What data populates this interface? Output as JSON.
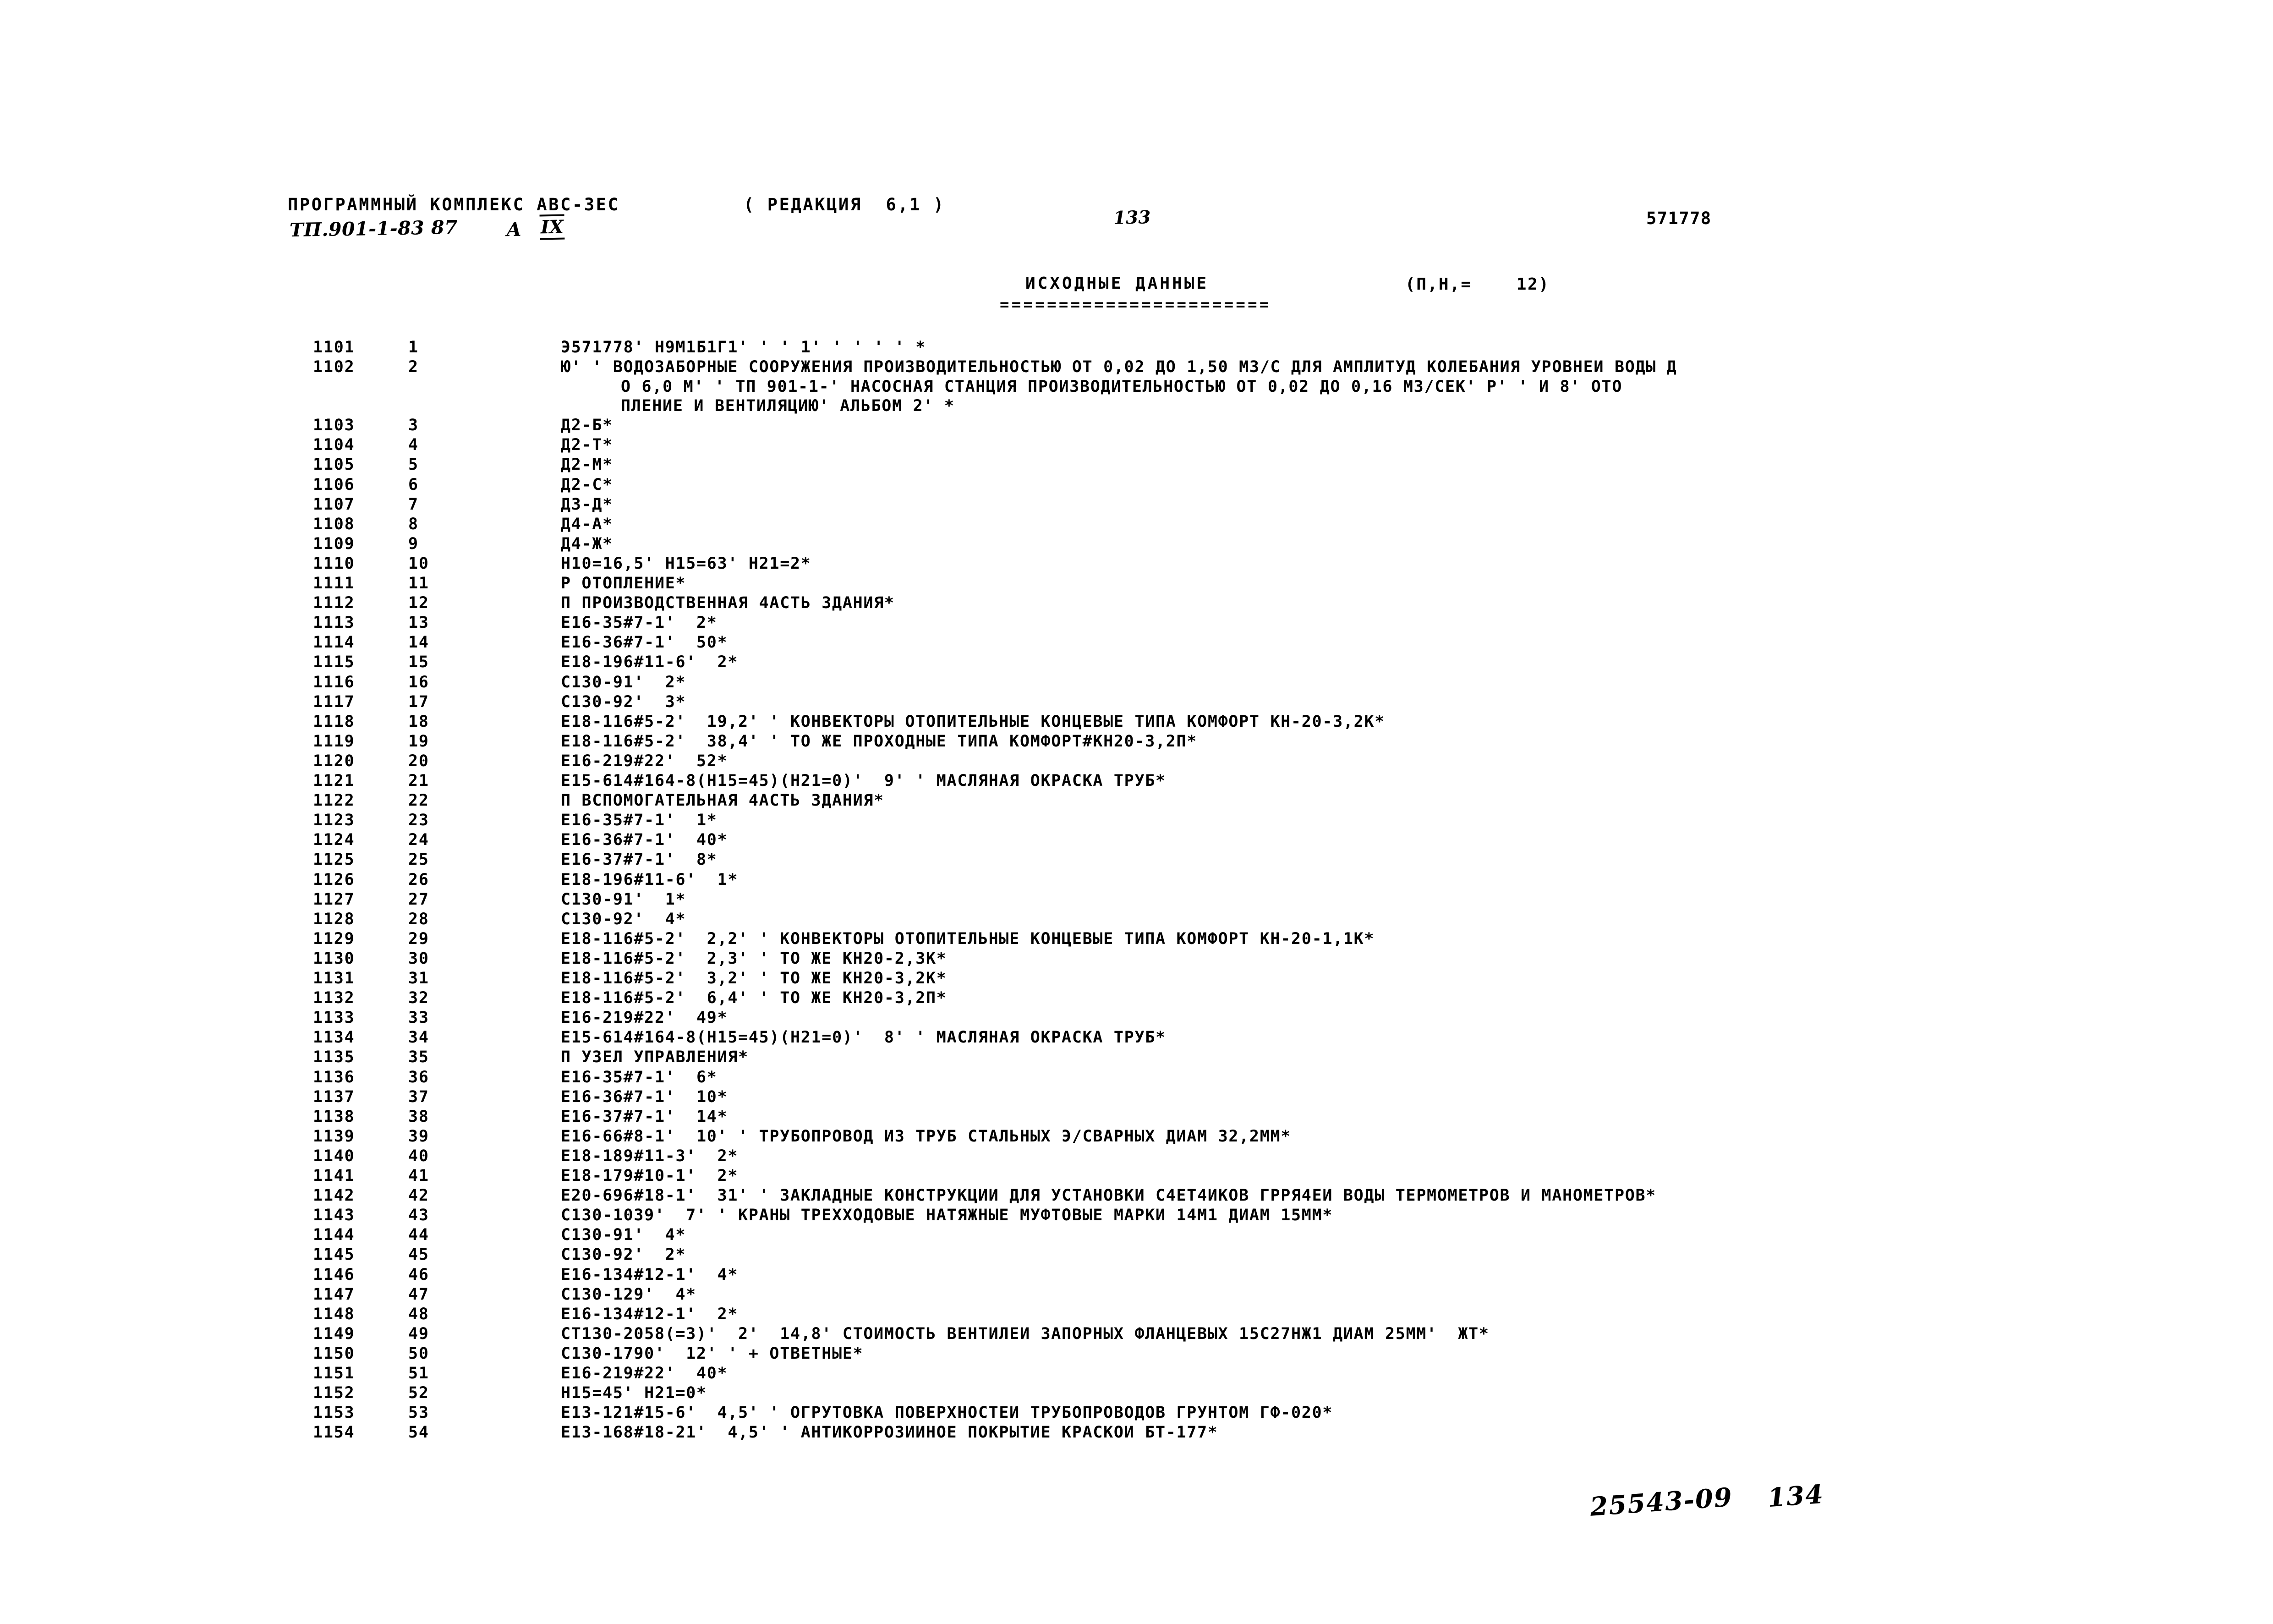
{
  "header": {
    "program_complex": "ПРОГРАММНЫЙ КОМПЛЕКС АВС-3ЕС",
    "revision": "( РЕДАКЦИЯ  6,1 )",
    "page_number": "133",
    "doc_code": "571778",
    "tp_label": "ТП.901-1-83 87",
    "album_letter": "А",
    "album_roman": "IX"
  },
  "section": {
    "title": "ИСХОДНЫЕ ДАННЫЕ",
    "rule": "=======================",
    "params": "(П,Н,=    12)"
  },
  "table": {
    "rows": [
      {
        "seq": "1101",
        "num": "1",
        "text": "Э571778' Н9М1Б1Г1' ' ' 1' ' ' ' ' *"
      },
      {
        "seq": "1102",
        "num": "2",
        "text": "Ю' ' ВОДОЗАБОРНЫЕ СООРУЖЕНИЯ ПРОИЗВОДИТЕЛЬНОСТЬЮ ОТ 0,02 ДО 1,50 М3/С ДЛЯ АМПЛИТУД КОЛЕБАНИЯ УРОВНЕИ ВОДЫ Д",
        "cont": [
          "О 6,0 М' ' ТП 901-1-' НАСОСНАЯ СТАНЦИЯ ПРОИЗВОДИТЕЛЬНОСТЬЮ ОТ 0,02 ДО 0,16 М3/СЕК' Р' ' И 8' ОТО",
          "ПЛЕНИЕ И ВЕНТИЛЯЦИЮ' АЛЬБОМ 2' *"
        ]
      },
      {
        "seq": "1103",
        "num": "3",
        "text": "Д2-Б*"
      },
      {
        "seq": "1104",
        "num": "4",
        "text": "Д2-Т*"
      },
      {
        "seq": "1105",
        "num": "5",
        "text": "Д2-М*"
      },
      {
        "seq": "1106",
        "num": "6",
        "text": "Д2-С*"
      },
      {
        "seq": "1107",
        "num": "7",
        "text": "Д3-Д*"
      },
      {
        "seq": "1108",
        "num": "8",
        "text": "Д4-А*"
      },
      {
        "seq": "1109",
        "num": "9",
        "text": "Д4-Ж*"
      },
      {
        "seq": "1110",
        "num": "10",
        "text": "Н10=16,5' Н15=63' Н21=2*"
      },
      {
        "seq": "1111",
        "num": "11",
        "text": "Р ОТОПЛЕНИЕ*"
      },
      {
        "seq": "1112",
        "num": "12",
        "text": "П ПРОИЗВОДСТВЕННАЯ 4АСТЬ ЗДАНИЯ*"
      },
      {
        "seq": "1113",
        "num": "13",
        "text": "Е16-35#7-1'  2*"
      },
      {
        "seq": "1114",
        "num": "14",
        "text": "Е16-36#7-1'  50*"
      },
      {
        "seq": "1115",
        "num": "15",
        "text": "Е18-196#11-6'  2*"
      },
      {
        "seq": "1116",
        "num": "16",
        "text": "С130-91'  2*"
      },
      {
        "seq": "1117",
        "num": "17",
        "text": "С130-92'  3*"
      },
      {
        "seq": "1118",
        "num": "18",
        "text": "Е18-116#5-2'  19,2' ' КОНВЕКТОРЫ ОТОПИТЕЛЬНЫЕ КОНЦЕВЫЕ ТИПА КОМФОРТ КН-20-3,2К*"
      },
      {
        "seq": "1119",
        "num": "19",
        "text": "Е18-116#5-2'  38,4' ' ТО ЖЕ ПРОХОДНЫЕ ТИПА КОМФОРТ#КН20-3,2П*"
      },
      {
        "seq": "1120",
        "num": "20",
        "text": "Е16-219#22'  52*"
      },
      {
        "seq": "1121",
        "num": "21",
        "text": "Е15-614#164-8(Н15=45)(Н21=0)'  9' ' МАСЛЯНАЯ ОКРАСКА ТРУБ*"
      },
      {
        "seq": "1122",
        "num": "22",
        "text": "П ВСПОМОГАТЕЛЬНАЯ 4АСТЬ ЗДАНИЯ*"
      },
      {
        "seq": "1123",
        "num": "23",
        "text": "Е16-35#7-1'  1*"
      },
      {
        "seq": "1124",
        "num": "24",
        "text": "Е16-36#7-1'  40*"
      },
      {
        "seq": "1125",
        "num": "25",
        "text": "Е16-37#7-1'  8*"
      },
      {
        "seq": "1126",
        "num": "26",
        "text": "Е18-196#11-6'  1*"
      },
      {
        "seq": "1127",
        "num": "27",
        "text": "С130-91'  1*"
      },
      {
        "seq": "1128",
        "num": "28",
        "text": "С130-92'  4*"
      },
      {
        "seq": "1129",
        "num": "29",
        "text": "Е18-116#5-2'  2,2' ' КОНВЕКТОРЫ ОТОПИТЕЛЬНЫЕ КОНЦЕВЫЕ ТИПА КОМФОРТ КН-20-1,1К*"
      },
      {
        "seq": "1130",
        "num": "30",
        "text": "Е18-116#5-2'  2,3' ' ТО ЖЕ КН20-2,3К*"
      },
      {
        "seq": "1131",
        "num": "31",
        "text": "Е18-116#5-2'  3,2' ' ТО ЖЕ КН20-3,2К*"
      },
      {
        "seq": "1132",
        "num": "32",
        "text": "Е18-116#5-2'  6,4' ' ТО ЖЕ КН20-3,2П*"
      },
      {
        "seq": "1133",
        "num": "33",
        "text": "Е16-219#22'  49*"
      },
      {
        "seq": "1134",
        "num": "34",
        "text": "Е15-614#164-8(Н15=45)(Н21=0)'  8' ' МАСЛЯНАЯ ОКРАСКА ТРУБ*"
      },
      {
        "seq": "1135",
        "num": "35",
        "text": "П УЗЕЛ УПРАВЛЕНИЯ*"
      },
      {
        "seq": "1136",
        "num": "36",
        "text": "Е16-35#7-1'  6*"
      },
      {
        "seq": "1137",
        "num": "37",
        "text": "Е16-36#7-1'  10*"
      },
      {
        "seq": "1138",
        "num": "38",
        "text": "Е16-37#7-1'  14*"
      },
      {
        "seq": "1139",
        "num": "39",
        "text": "Е16-66#8-1'  10' ' ТРУБОПРОВОД ИЗ ТРУБ СТАЛЬНЫХ Э/СВАРНЫХ ДИАМ 32,2ММ*"
      },
      {
        "seq": "1140",
        "num": "40",
        "text": "Е18-189#11-3'  2*"
      },
      {
        "seq": "1141",
        "num": "41",
        "text": "Е18-179#10-1'  2*"
      },
      {
        "seq": "1142",
        "num": "42",
        "text": "Е20-696#18-1'  31' ' ЗАКЛАДНЫЕ КОНСТРУКЦИИ ДЛЯ УСТАНОВКИ С4ЕТ4ИКОВ ГРРЯ4ЕИ ВОДЫ ТЕРМОМЕТРОВ И МАНОМЕТРОВ*"
      },
      {
        "seq": "1143",
        "num": "43",
        "text": "С130-1039'  7' ' КРАНЫ ТРЕХХОДОВЫЕ НАТЯЖНЫЕ МУФТОВЫЕ МАРКИ 14М1 ДИАМ 15ММ*"
      },
      {
        "seq": "1144",
        "num": "44",
        "text": "С130-91'  4*"
      },
      {
        "seq": "1145",
        "num": "45",
        "text": "С130-92'  2*"
      },
      {
        "seq": "1146",
        "num": "46",
        "text": "Е16-134#12-1'  4*"
      },
      {
        "seq": "1147",
        "num": "47",
        "text": "С130-129'  4*"
      },
      {
        "seq": "1148",
        "num": "48",
        "text": "Е16-134#12-1'  2*"
      },
      {
        "seq": "1149",
        "num": "49",
        "text": "СТ130-2058(=3)'  2'  14,8' СТОИМОСТЬ ВЕНТИЛЕИ ЗАПОРНЫХ ФЛАНЦЕВЫХ 15С27НЖ1 ДИАМ 25ММ'  ЖТ*"
      },
      {
        "seq": "1150",
        "num": "50",
        "text": "С130-1790'  12' ' + ОТВЕТНЫЕ*"
      },
      {
        "seq": "1151",
        "num": "51",
        "text": "Е16-219#22'  40*"
      },
      {
        "seq": "1152",
        "num": "52",
        "text": "Н15=45' Н21=0*"
      },
      {
        "seq": "1153",
        "num": "53",
        "text": "Е13-121#15-6'  4,5' ' ОГРУТОВКА ПОВЕРХНОСТЕИ ТРУБОПРОВОДОВ ГРУНТОМ ГФ-020*"
      },
      {
        "seq": "1154",
        "num": "54",
        "text": "Е13-168#18-21'  4,5' ' АНТИКОРРОЗИИНОЕ ПОКРЫТИЕ КРАСКОИ БТ-177*"
      }
    ]
  },
  "annotations": {
    "handwritten_code": "25543-09",
    "handwritten_page": "134"
  }
}
